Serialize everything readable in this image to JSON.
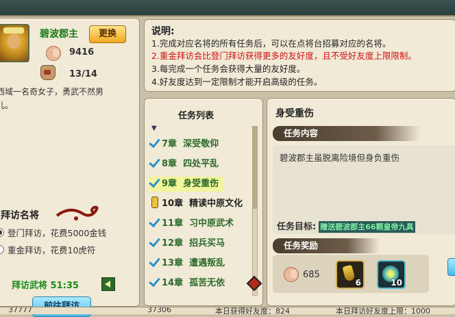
{
  "character": {
    "name": "碧波郡主",
    "change_label": "更换",
    "favor": "9416",
    "visits": "13/14",
    "description_line1": "西域一名奇女子，勇武不然男",
    "description_line2": "儿。"
  },
  "visit": {
    "title": "拜访名将",
    "option1": "登门拜访，花费5000金钱",
    "option2": "重金拜访，花费10虎符",
    "timer_label": "拜访武将 51:35",
    "go_button": "前往拜访"
  },
  "notes": {
    "title": "说明:",
    "lines": [
      "1.完成对应名将的所有任务后，可以在点将台招募对应的名将。",
      "2.重金拜访会比登门拜访获得更多的友好度，且不受好友度上限限制。",
      "3.每完成一个任务会获得大量的友好度。",
      "4.好友度达到一定限制才能开启高级的任务。"
    ]
  },
  "task_list": {
    "title": "任务列表",
    "items": [
      {
        "chapter": "7章",
        "name": "深受敬仰",
        "state": "done"
      },
      {
        "chapter": "8章",
        "name": "四处平乱",
        "state": "done"
      },
      {
        "chapter": "9章",
        "name": "身受重伤",
        "state": "active"
      },
      {
        "chapter": "10章",
        "name": "精读中原文化",
        "state": "locked"
      },
      {
        "chapter": "11章",
        "name": "习中原武术",
        "state": "done"
      },
      {
        "chapter": "12章",
        "name": "招兵买马",
        "state": "done"
      },
      {
        "chapter": "13章",
        "name": "遭遇叛乱",
        "state": "done"
      },
      {
        "chapter": "14章",
        "name": "孤苦无依",
        "state": "done"
      }
    ]
  },
  "detail": {
    "title": "身受重伤",
    "content_header": "任务内容",
    "content_text": "碧波郡主虽脱离险境但身负重伤",
    "target_label": "任务目标:",
    "target_value": "赠送碧波郡主66颗皇帝九具",
    "reward_header": "任务奖励",
    "reward_favor": "685",
    "reward_items": [
      {
        "icon": "gold-cup-icon",
        "count": "6"
      },
      {
        "icon": "jade-orb-icon",
        "count": "10"
      }
    ]
  },
  "footer": {
    "gold": "37777",
    "tiger": "37306",
    "today_favor": "本日获得好友度：824",
    "today_limit": "本日拜访好友度上限：1000"
  }
}
